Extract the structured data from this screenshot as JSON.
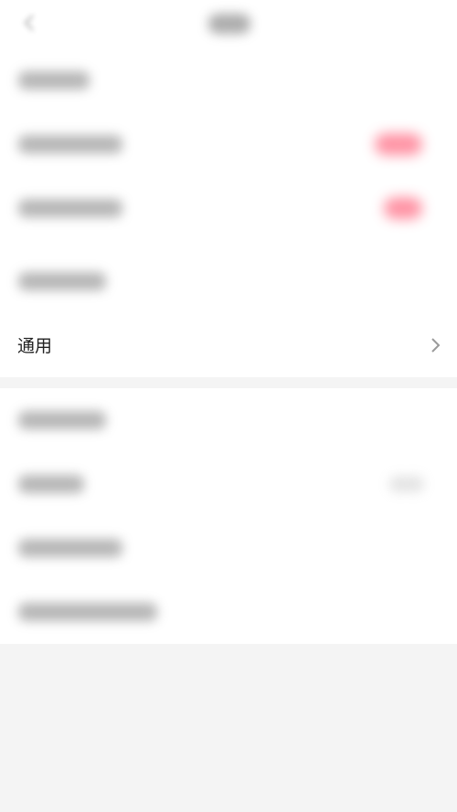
{
  "colors": {
    "page_background": "#f4f4f4",
    "card_background": "#ffffff",
    "toggle_accent": "#ff6f86",
    "text_primary": "#222222",
    "chevron": "#9a9a9a"
  },
  "header": {
    "back_icon": "back-arrow-icon",
    "title": ""
  },
  "settings": {
    "general_label": "通用",
    "general_icon": "chevron-right-icon"
  }
}
